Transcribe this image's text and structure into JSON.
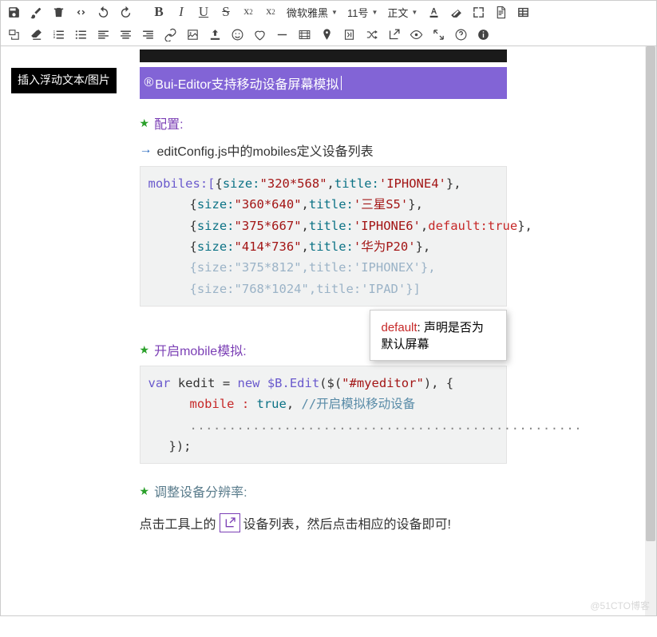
{
  "toolbar": {
    "row1": [
      {
        "name": "save-icon",
        "glyph": "save"
      },
      {
        "name": "brush-icon",
        "glyph": "brush"
      },
      {
        "name": "trash-icon",
        "glyph": "trash"
      },
      {
        "name": "code-icon",
        "glyph": "code"
      },
      {
        "name": "undo-icon",
        "glyph": "undo"
      },
      {
        "name": "redo-icon",
        "glyph": "redo"
      }
    ],
    "format": [
      "bold-icon",
      "italic-icon",
      "underline-icon",
      "strike-icon",
      "superscript-icon",
      "subscript-icon"
    ],
    "selects": {
      "font": "微软雅黑",
      "size": "11号",
      "style": "正文"
    },
    "row1_end": [
      "text-color-icon",
      "highlight-icon",
      "fullscreen2-icon",
      "page-icon",
      "table-icon"
    ],
    "row2": [
      "insert-float-icon",
      "eraser-icon",
      "ordered-list-icon",
      "unordered-list-icon",
      "align-left-icon",
      "align-center-icon",
      "align-right-icon",
      "link-icon",
      "image-icon",
      "upload-icon",
      "emoji-icon",
      "heart-icon",
      "minus-icon",
      "video-icon",
      "marker-icon",
      "symbol-icon",
      "shuffle-icon",
      "export-icon",
      "eye-icon",
      "expand-icon",
      "help-icon",
      "info-icon"
    ]
  },
  "tooltip": "插入浮动文本/图片",
  "header": "Bui-Editor支持移动设备屏幕模拟",
  "sections": {
    "s1": "配置:",
    "s1_sub": "editConfig.js中的mobiles定义设备列表",
    "s2": "开启mobile模拟:",
    "s3": "调整设备分辨率:",
    "device_line_before": "点击工具上的",
    "device_line_after": "设备列表，然后点击相应的设备即可!"
  },
  "code1": {
    "prefix": "mobiles:[",
    "rows": [
      {
        "size": "320*568",
        "title": "IPHONE4",
        "tail": "},"
      },
      {
        "size": "360*640",
        "title": "三星S5",
        "tail": "},"
      },
      {
        "size": "375*667",
        "title": "IPHONE6",
        "tail": ",",
        "def": "default:true",
        "end": "},"
      },
      {
        "size": "414*736",
        "title": "华为P20",
        "tail": "},"
      }
    ],
    "dim_rows": [
      {
        "size": "375*812",
        "title": "IPHONEX",
        "tail": "},"
      },
      {
        "size": "768*1024",
        "title": "IPAD",
        "tail": "}]"
      }
    ]
  },
  "popover": {
    "key": "default",
    "text": ": 声明是否为默认屏幕"
  },
  "code2": {
    "l1_var": "var ",
    "l1_name": "kedit",
    "l1_eq": " = ",
    "l1_new": "new ",
    "l1_cls": "$B.Edit",
    "l1_args": "($(",
    "l1_str": "\"#myeditor\"",
    "l1_close": "), {",
    "l2_key": "mobile : ",
    "l2_val": "true",
    "l2_comma": ", ",
    "l2_comment": "//开启模拟移动设备",
    "l3_dots": "..................................................",
    "l4": "});"
  },
  "watermark": "@51CTO博客"
}
